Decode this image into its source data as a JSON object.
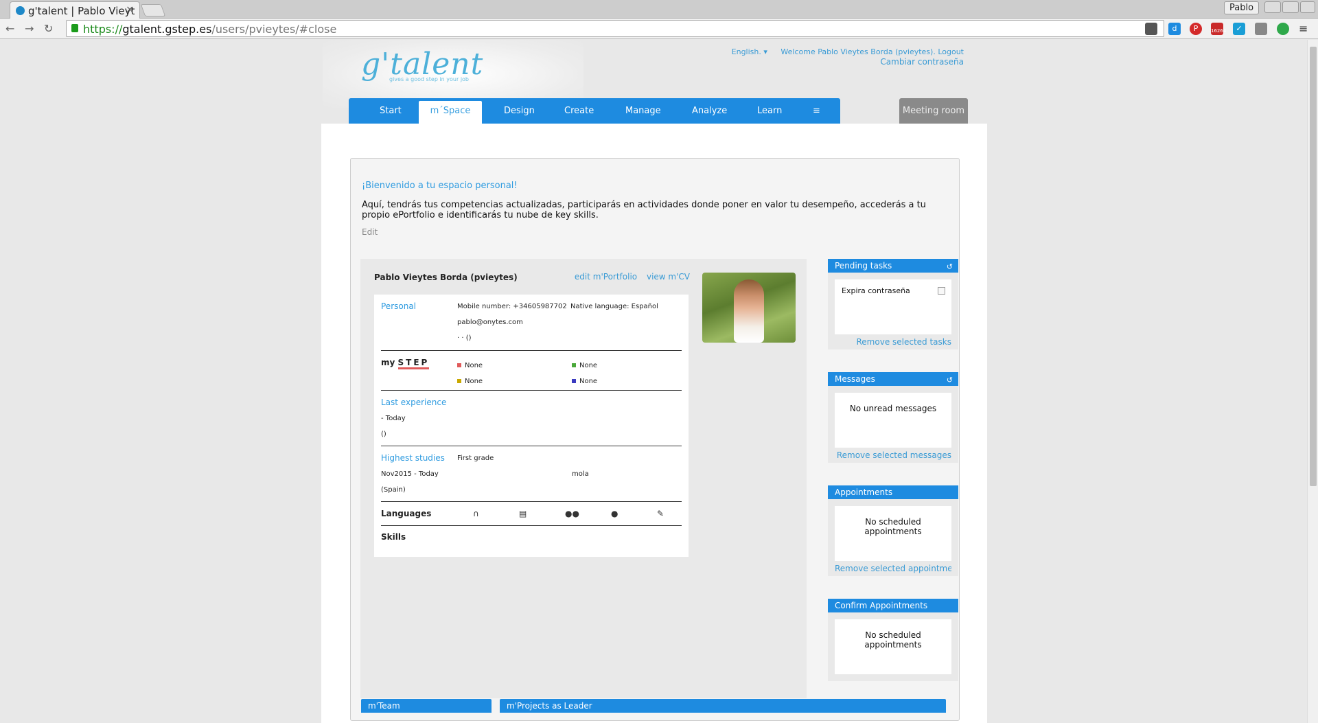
{
  "browser": {
    "tab_title": "g'talent | Pablo Vieyt",
    "tab_close": "×",
    "profile_name": "Pablo",
    "url_https": "https://",
    "url_host": "gtalent.gstep.es",
    "url_path": "/users/pvieytes/#close",
    "gmail_badge": "16264"
  },
  "header": {
    "logo_text": "g'talent",
    "logo_tagline": "gives a good step in your job",
    "language": "English.",
    "welcome": "Welcome Pablo Vieytes Borda (pvieytes).",
    "logout": "Logout",
    "change_password": "Cambiar contraseña"
  },
  "nav": {
    "items": [
      "Start",
      "m´Space",
      "Design",
      "Create",
      "Manage",
      "Analyze",
      "Learn",
      "≡"
    ],
    "active": "m´Space",
    "meeting_room": "Meeting room"
  },
  "welcome": {
    "title": "¡Bienvenido a tu espacio personal!",
    "text": "Aquí, tendrás tus competencias actualizadas, participarás en actividades donde poner en valor tu desempeño, accederás a tu propio ePortfolio e identificarás tu nube de key skills.",
    "edit": "Edit"
  },
  "profile": {
    "name": "Pablo Vieytes Borda (pvieytes)",
    "edit_portfolio": "edit m'Portfolio",
    "view_cv": "view m'CV",
    "personal": {
      "label": "Personal",
      "mobile": "Mobile number: +34605987702",
      "native_language": "Native language: Español",
      "email": "pablo@onytes.com",
      "address": "· · ()"
    },
    "mystep": {
      "label_my": "my",
      "label_step": "STEP",
      "items": [
        {
          "value": "None",
          "color": "#e05a5a"
        },
        {
          "value": "None",
          "color": "#4aa83a"
        },
        {
          "value": "None",
          "color": "#c9a800"
        },
        {
          "value": "None",
          "color": "#3a3ac0"
        }
      ]
    },
    "last_experience": {
      "label": "Last experience",
      "period": "- Today",
      "detail": "()"
    },
    "highest_studies": {
      "label": "Highest studies",
      "grade": "First grade",
      "period": "Nov2015 - Today",
      "place": "(Spain)",
      "name": "mola"
    },
    "languages_label": "Languages",
    "skills_label": "Skills"
  },
  "sidebar": {
    "pending_tasks": {
      "title": "Pending tasks",
      "task": "Expira contraseña",
      "link": "Remove selected tasks"
    },
    "messages": {
      "title": "Messages",
      "empty": "No unread messages",
      "link": "Remove selected messages"
    },
    "appointments": {
      "title": "Appointments",
      "empty": "No scheduled appointments",
      "link": "Remove selected appointme..."
    },
    "confirm_appointments": {
      "title": "Confirm Appointments",
      "empty": "No scheduled appointments"
    }
  },
  "bottom": {
    "team": "m'Team",
    "projects_leader": "m'Projects as Leader"
  }
}
